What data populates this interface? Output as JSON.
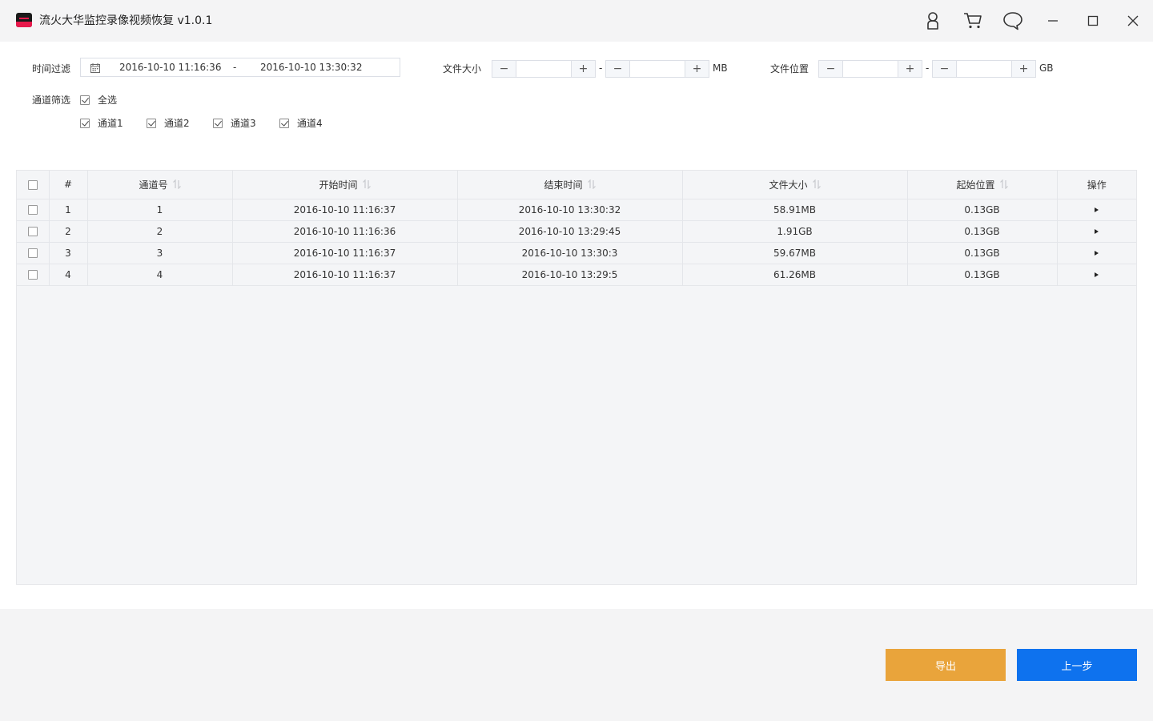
{
  "app": {
    "title": "流火大华监控录像视频恢复 v1.0.1"
  },
  "titlebar": {
    "icons": [
      "user-icon",
      "cart-icon",
      "chat-icon",
      "minimize-icon",
      "maximize-icon",
      "close-icon"
    ]
  },
  "filters": {
    "time": {
      "label": "时间过滤",
      "start": "2016-10-10 11:16:36",
      "separator": "-",
      "end": "2016-10-10 13:30:32"
    },
    "size": {
      "label": "文件大小",
      "min": "",
      "max": "",
      "separator": "-",
      "unit": "MB"
    },
    "position": {
      "label": "文件位置",
      "min": "",
      "max": "",
      "separator": "-",
      "unit": "GB"
    },
    "channel": {
      "label": "通道筛选",
      "select_all": "全选",
      "channels": [
        "通道1",
        "通道2",
        "通道3",
        "通道4"
      ]
    }
  },
  "table": {
    "columns": [
      "#",
      "通道号",
      "开始时间",
      "结束时间",
      "文件大小",
      "起始位置",
      "操作"
    ],
    "rows": [
      {
        "index": "1",
        "channel": "1",
        "start": "2016-10-10 11:16:37",
        "end": "2016-10-10 13:30:32",
        "size": "58.91MB",
        "position": "0.13GB"
      },
      {
        "index": "2",
        "channel": "2",
        "start": "2016-10-10 11:16:36",
        "end": "2016-10-10 13:29:45",
        "size": "1.91GB",
        "position": "0.13GB"
      },
      {
        "index": "3",
        "channel": "3",
        "start": "2016-10-10 11:16:37",
        "end": "2016-10-10 13:30:3",
        "size": "59.67MB",
        "position": "0.13GB"
      },
      {
        "index": "4",
        "channel": "4",
        "start": "2016-10-10 11:16:37",
        "end": "2016-10-10 13:29:5",
        "size": "61.26MB",
        "position": "0.13GB"
      }
    ]
  },
  "footer": {
    "export_label": "导出",
    "prev_label": "上一步"
  },
  "colors": {
    "export": "#e9a43b",
    "prev": "#0e72ee"
  }
}
